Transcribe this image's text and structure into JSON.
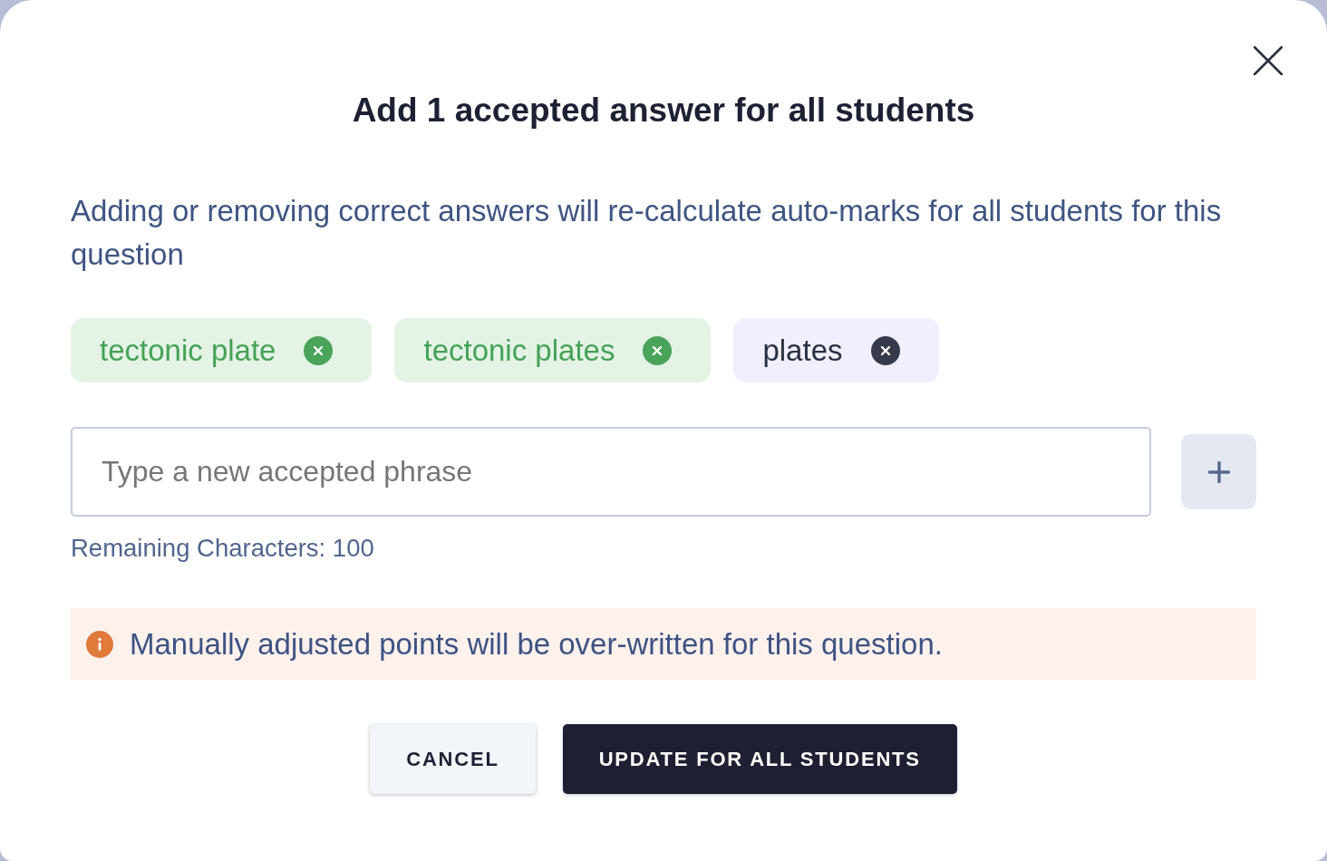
{
  "title": "Add 1 accepted answer for all students",
  "description": "Adding or removing correct answers will re-calculate auto-marks for all students for this question",
  "answers": [
    {
      "label": "tectonic plate",
      "new": false
    },
    {
      "label": "tectonic plates",
      "new": false
    },
    {
      "label": "plates",
      "new": true
    }
  ],
  "phrase_input": {
    "placeholder": "Type a new accepted phrase"
  },
  "remaining": "Remaining Characters: 100",
  "warning": "Manually adjusted points will be over-written for this question.",
  "buttons": [
    {
      "label": "CANCEL",
      "kind": "secondary"
    },
    {
      "label": "UPDATE FOR ALL STUDENTS",
      "kind": "primary"
    }
  ]
}
